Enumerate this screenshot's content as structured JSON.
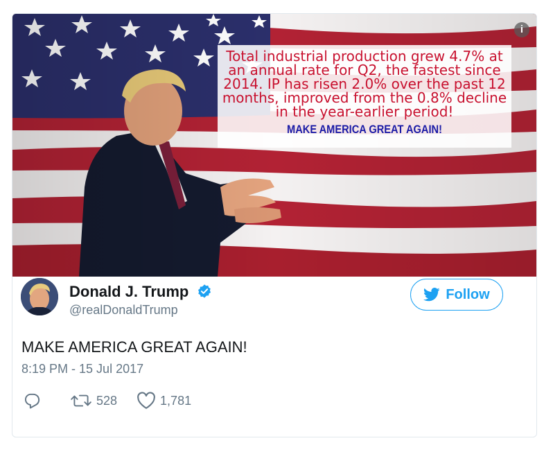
{
  "media": {
    "overlay_lines": [
      "Total industrial production grew 4.7% at",
      "an annual rate for Q2, the fastest since",
      "2014. IP has risen 2.0% over the past 12",
      "months, improved from the 0.8% decline",
      "in the year-earlier period!"
    ],
    "overlay_slogan": "MAKE AMERICA GREAT AGAIN!",
    "info_glyph": "i"
  },
  "author": {
    "name": "Donald J. Trump",
    "handle": "@realDonaldTrump",
    "verified": true
  },
  "follow_label": "Follow",
  "tweet": {
    "text": "MAKE AMERICA GREAT AGAIN!",
    "timestamp": "8:19 PM - 15 Jul 2017"
  },
  "actions": {
    "retweets": "528",
    "likes": "1,781"
  },
  "colors": {
    "accent": "#1da1f2",
    "flag_red": "#b22234",
    "flag_blue": "#2b2f6b",
    "overlay_text_red": "#c8102e",
    "slogan_blue": "#1a1aa6"
  },
  "icons": [
    "info-icon",
    "verified-badge-icon",
    "twitter-bird-icon",
    "reply-icon",
    "retweet-icon",
    "heart-icon"
  ]
}
